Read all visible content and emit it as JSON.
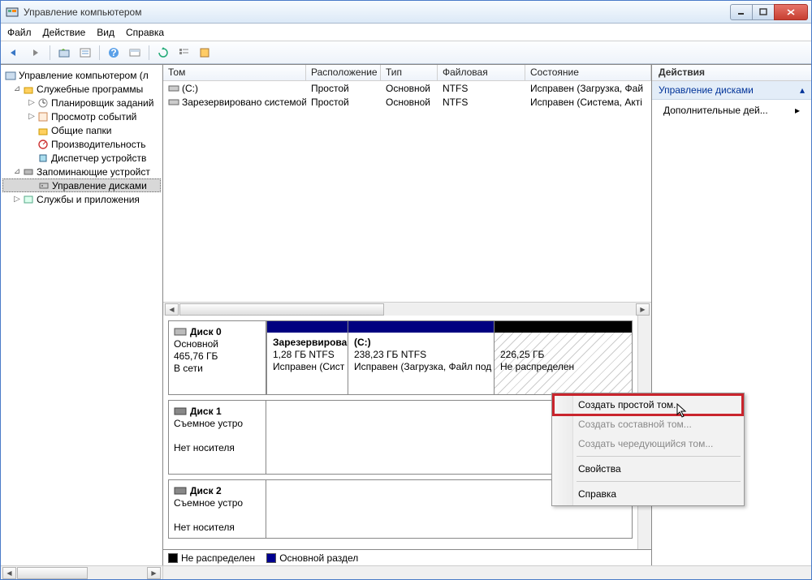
{
  "window": {
    "title": "Управление компьютером"
  },
  "menu": {
    "file": "Файл",
    "action": "Действие",
    "view": "Вид",
    "help": "Справка"
  },
  "tree": {
    "root": "Управление компьютером (л",
    "sys_tools": "Служебные программы",
    "task_scheduler": "Планировщик заданий",
    "event_viewer": "Просмотр событий",
    "shared_folders": "Общие папки",
    "performance": "Производительность",
    "device_mgr": "Диспетчер устройств",
    "storage": "Запоминающие устройст",
    "disk_mgmt": "Управление дисками",
    "services": "Службы и приложения"
  },
  "cols": {
    "volume": "Том",
    "layout": "Расположение",
    "type": "Тип",
    "fs": "Файловая система",
    "status": "Состояние"
  },
  "vols": [
    {
      "name": "(C:)",
      "layout": "Простой",
      "type": "Основной",
      "fs": "NTFS",
      "status": "Исправен (Загрузка, Фай"
    },
    {
      "name": "Зарезервировано системой",
      "layout": "Простой",
      "type": "Основной",
      "fs": "NTFS",
      "status": "Исправен (Система, Акті"
    }
  ],
  "disk0": {
    "name": "Диск 0",
    "type": "Основной",
    "size": "465,76 ГБ",
    "online": "В сети",
    "p1_name": "Зарезервирова",
    "p1_size": "1,28 ГБ NTFS",
    "p1_status": "Исправен (Сист",
    "p2_name": "(C:)",
    "p2_size": "238,23 ГБ NTFS",
    "p2_status": "Исправен (Загрузка, Файл под",
    "p3_size": "226,25 ГБ",
    "p3_status": "Не распределен"
  },
  "disk1": {
    "name": "Диск 1",
    "type": "Съемное устро",
    "status": "Нет носителя"
  },
  "disk2": {
    "name": "Диск 2",
    "type": "Съемное устро",
    "status": "Нет носителя"
  },
  "legend": {
    "unalloc": "Не распределен",
    "primary": "Основной раздел"
  },
  "actions": {
    "title": "Действия",
    "section": "Управление дисками",
    "more": "Дополнительные дей..."
  },
  "ctx": {
    "simple": "Создать простой том...",
    "spanned": "Создать составной том...",
    "striped": "Создать чередующийся том...",
    "props": "Свойства",
    "help": "Справка"
  }
}
